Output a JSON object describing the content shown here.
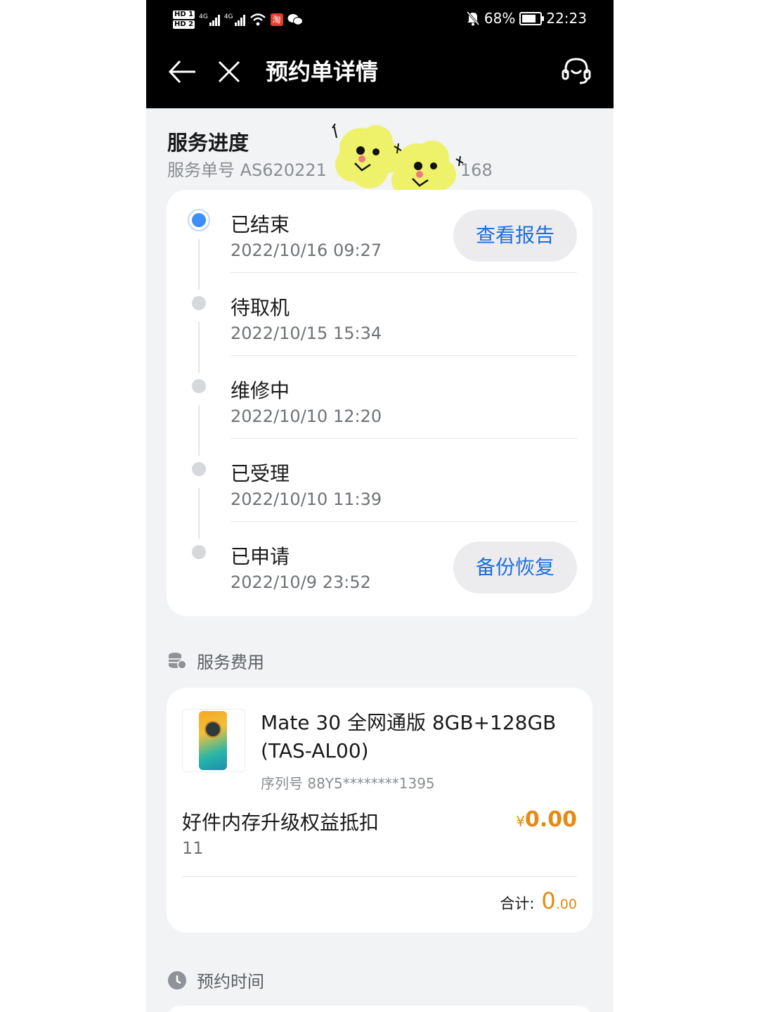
{
  "status_bar": {
    "hd1": "HD 1",
    "hd2": "HD 2",
    "net1": "4G",
    "net2": "4G",
    "taobao_glyph": "淘",
    "battery_text": "68%",
    "battery_level": 0.68,
    "time": "22:23"
  },
  "header": {
    "title": "预约单详情",
    "back_icon": "arrow-left-icon",
    "close_icon": "close-icon",
    "support_icon": "headset-icon"
  },
  "progress": {
    "title": "服务进度",
    "order_no": "服务单号 AS620221",
    "order_no_tail": "168",
    "steps": [
      {
        "name": "已结束",
        "time": "2022/10/16 09:27",
        "action": "查看报告"
      },
      {
        "name": "待取机",
        "time": "2022/10/15 15:34"
      },
      {
        "name": "维修中",
        "time": "2022/10/10 12:20"
      },
      {
        "name": "已受理",
        "time": "2022/10/10 11:39"
      },
      {
        "name": "已申请",
        "time": "2022/10/9 23:52",
        "action": "备份恢复"
      }
    ]
  },
  "fees": {
    "title": "服务费用",
    "product_name": "Mate 30 全网通版 8GB+128GB (TAS-AL00)",
    "serial": "序列号  88Y5********1395",
    "perk_name": "好件内存升级权益抵扣",
    "perk_qty": "11",
    "perk_currency": "¥",
    "perk_amount": "0.00",
    "total_label": "合计:",
    "total_int": "0",
    "total_dec": ".00"
  },
  "appointment": {
    "title": "预约时间"
  },
  "colors": {
    "accent_blue": "#1f6fd8",
    "active_dot": "#3e8ef7",
    "price_orange": "#e58a12"
  }
}
